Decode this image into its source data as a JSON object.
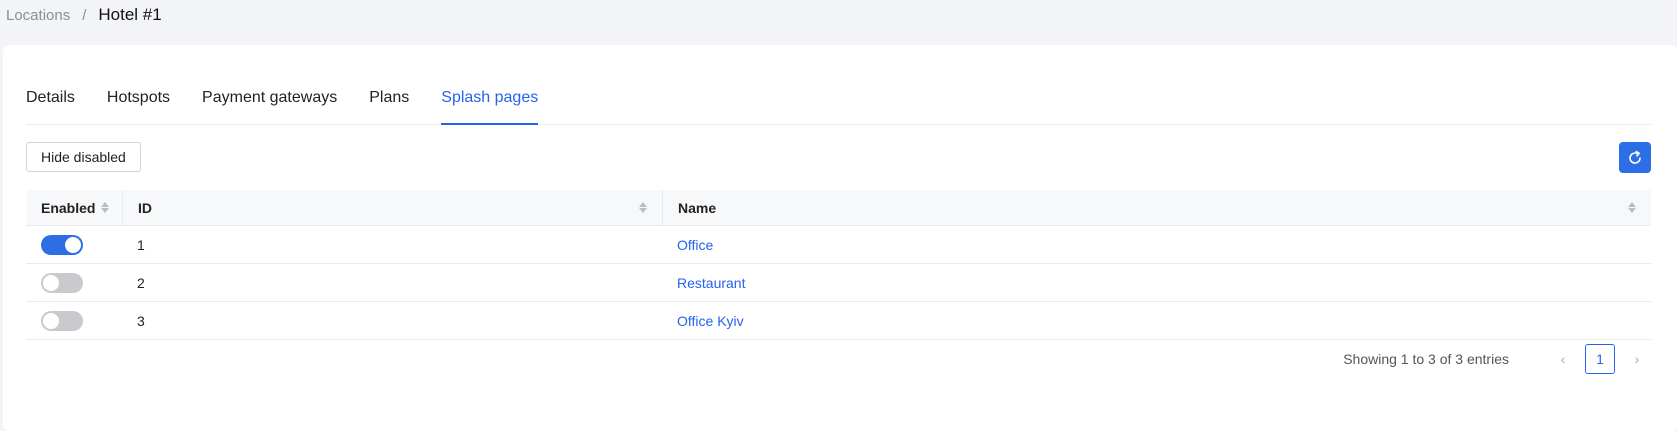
{
  "breadcrumb": {
    "parent": "Locations",
    "separator": "/",
    "current": "Hotel #1"
  },
  "tabs": [
    {
      "label": "Details",
      "active": false
    },
    {
      "label": "Hotspots",
      "active": false
    },
    {
      "label": "Payment gateways",
      "active": false
    },
    {
      "label": "Plans",
      "active": false
    },
    {
      "label": "Splash pages",
      "active": true
    }
  ],
  "toolbar": {
    "hide_disabled_label": "Hide disabled",
    "refresh_icon": "refresh-icon"
  },
  "table": {
    "columns": [
      "Enabled",
      "ID",
      "Name"
    ],
    "rows": [
      {
        "enabled": true,
        "id": "1",
        "name": "Office"
      },
      {
        "enabled": false,
        "id": "2",
        "name": "Restaurant"
      },
      {
        "enabled": false,
        "id": "3",
        "name": "Office Kyiv"
      }
    ]
  },
  "pagination": {
    "summary": "Showing 1 to 3 of 3 entries",
    "current_page": "1",
    "prev": "‹",
    "next": "›"
  },
  "colors": {
    "accent": "#2563eb",
    "toggle_on": "#2b6ee6",
    "toggle_off": "#c8cacd"
  }
}
